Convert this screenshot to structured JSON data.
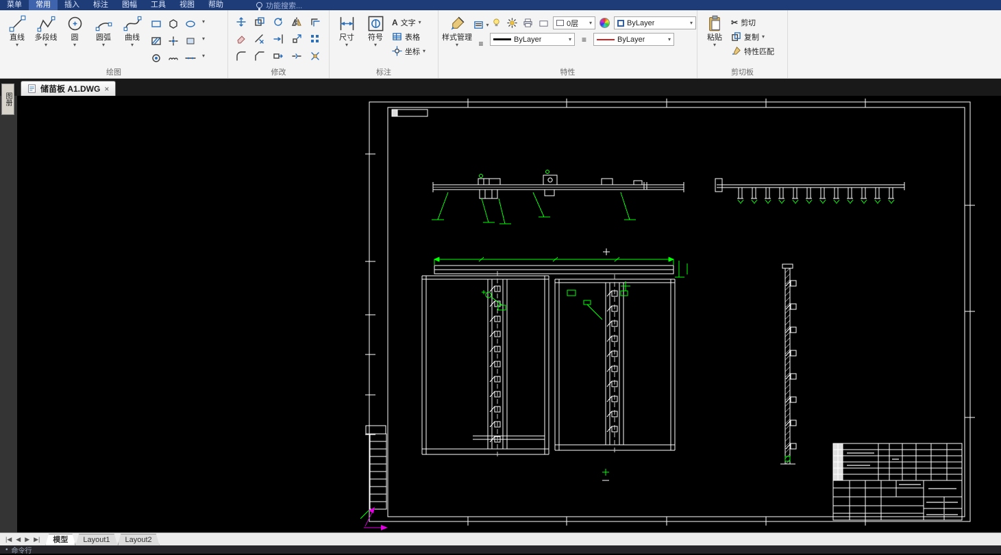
{
  "icons": {
    "chevron_down": "▾",
    "scissors": "✂",
    "menu_lines": "≡",
    "nav_first": "|◀",
    "nav_prev": "◀",
    "nav_next": "▶",
    "nav_last": "▶|",
    "close": "×",
    "text_glyph": "A",
    "bullet": "•"
  },
  "menu_bar": {
    "items": [
      {
        "label": "菜单"
      },
      {
        "label": "常用"
      },
      {
        "label": "插入"
      },
      {
        "label": "标注"
      },
      {
        "label": "图幅"
      },
      {
        "label": "工具"
      },
      {
        "label": "视图"
      },
      {
        "label": "帮助"
      }
    ],
    "active": "常用",
    "search_placeholder": "功能搜索..."
  },
  "ribbon": {
    "draw_group": {
      "label": "绘图",
      "buttons": [
        {
          "label": "直线"
        },
        {
          "label": "多段线"
        },
        {
          "label": "圆"
        },
        {
          "label": "圆弧"
        },
        {
          "label": "曲线"
        }
      ]
    },
    "modify_group": {
      "label": "修改"
    },
    "annotate_group": {
      "label": "标注",
      "buttons": [
        {
          "label": "尺寸"
        },
        {
          "label": "符号"
        }
      ],
      "small_buttons": [
        {
          "label": "文字"
        },
        {
          "label": "表格"
        },
        {
          "label": "坐标"
        }
      ]
    },
    "properties_group": {
      "label": "特性",
      "style_manager_label": "样式管理",
      "layer_value": "0层",
      "color_value": "ByLayer",
      "lineweight_value": "ByLayer",
      "linetype_value": "ByLayer"
    },
    "clipboard_group": {
      "label": "剪切板",
      "paste_label": "粘贴",
      "cut_label": "剪切",
      "copy_label": "复制",
      "match_label": "特性匹配"
    }
  },
  "document_tab": {
    "title": "储苗板 A1.DWG"
  },
  "side_tab": {
    "label": "图册"
  },
  "layout_bar": {
    "tabs": [
      {
        "label": "模型"
      },
      {
        "label": "Layout1"
      },
      {
        "label": "Layout2"
      }
    ],
    "active": "模型"
  },
  "command_bar": {
    "label": "命令行"
  },
  "colors": {
    "menu_bg": "#1d3c78",
    "canvas_bg": "#000000",
    "geometry": "#ffffff",
    "dimension": "#00ff00",
    "ucs": "#e000e0"
  }
}
